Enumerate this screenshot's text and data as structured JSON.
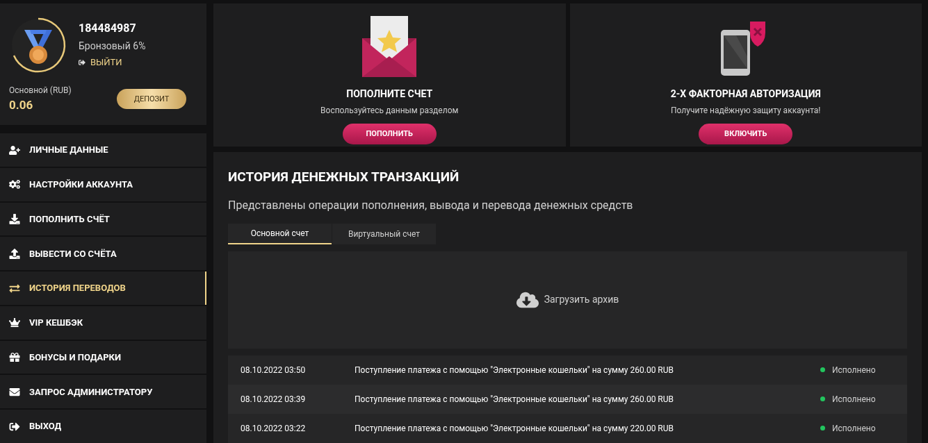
{
  "profile": {
    "user_id": "184484987",
    "rank": "Бронзовый 6%",
    "logout": "ВЫЙТИ",
    "balance_label": "Основной (RUB)",
    "balance": "0.06",
    "deposit_button": "ДЕПОЗИТ"
  },
  "menu": [
    {
      "kind": "user-plus",
      "label": "ЛИЧНЫЕ ДАННЫЕ",
      "selected": false
    },
    {
      "kind": "cogs",
      "label": "НАСТРОЙКИ АККАУНТА",
      "selected": false
    },
    {
      "kind": "download",
      "label": "ПОПОЛНИТЬ СЧЁТ",
      "selected": false
    },
    {
      "kind": "upload",
      "label": "ВЫВЕСТИ СО СЧЁТА",
      "selected": false
    },
    {
      "kind": "exchange",
      "label": "ИСТОРИЯ ПЕРЕВОДОВ",
      "selected": true
    },
    {
      "kind": "crown",
      "label": "VIP КЕШБЭК",
      "selected": false
    },
    {
      "kind": "gift",
      "label": "БОНУСЫ И ПОДАРКИ",
      "selected": false
    },
    {
      "kind": "envelope",
      "label": "ЗАПРОС АДМИНИСТРАТОРУ",
      "selected": false
    },
    {
      "kind": "exit",
      "label": "ВЫХОД",
      "selected": false
    }
  ],
  "promo_cards": [
    {
      "kind": "envelope",
      "title": "ПОПОЛНИТЕ СЧЕТ",
      "text": "Воспользуйтесь данным разделом",
      "button": "ПОПОЛНИТЬ"
    },
    {
      "kind": "phone",
      "title": "2-Х ФАКТОРНАЯ АВТОРИЗАЦИЯ",
      "text": "Получите надёжную защиту аккаунта!",
      "button": "ВКЛЮЧИТЬ"
    }
  ],
  "history": {
    "title": "ИСТОРИЯ ДЕНЕЖНЫХ ТРАНЗАКЦИЙ",
    "subtitle": "Представлены операции пополнения, вывода и перевода денежных средств",
    "tabs": [
      {
        "label": "Основной счет",
        "selected": true
      },
      {
        "label": "Виртуальный счет",
        "selected": false
      }
    ],
    "archive_button": "Загрузить архив",
    "rows": [
      {
        "date": "08.10.2022 03:50",
        "description": "Поступление платежа с помощью \"Электронные кошельки\" на сумму 260.00 RUB",
        "status": "Исполнено",
        "color": "#22c55e"
      },
      {
        "date": "08.10.2022 03:39",
        "description": "Поступление платежа с помощью \"Электронные кошельки\" на сумму 260.00 RUB",
        "status": "Исполнено",
        "color": "#22c55e"
      },
      {
        "date": "08.10.2022 03:22",
        "description": "Поступление платежа с помощью \"Электронные кошельки\" на сумму 220.00 RUB",
        "status": "Исполнено",
        "color": "#22c55e"
      }
    ]
  }
}
